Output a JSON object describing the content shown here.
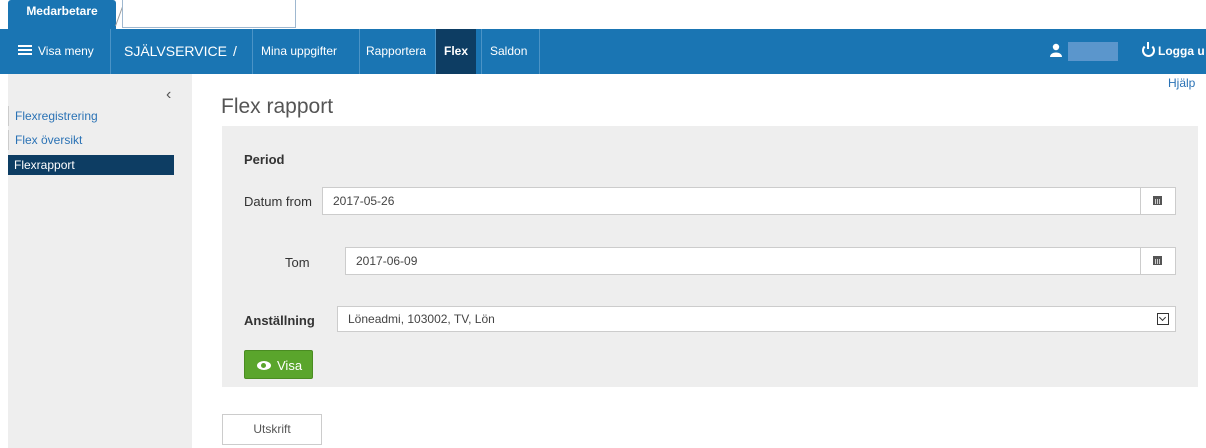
{
  "tabs": {
    "active_label": "Medarbetare"
  },
  "navbar": {
    "menu_label": "Visa meny",
    "section": "SJÄLVSERVICE",
    "separator": "/",
    "items": [
      "Mina uppgifter",
      "Rapportera",
      "Flex",
      "Saldon"
    ],
    "active_item": "Flex",
    "logout_label": "Logga u"
  },
  "sidebar": {
    "collapse_glyph": "‹",
    "items": [
      "Flexregistrering",
      "Flex översikt",
      "Flexrapport"
    ],
    "active_item": "Flexrapport"
  },
  "help_label": "Hjälp",
  "page": {
    "title": "Flex rapport",
    "period_label": "Period",
    "from_label": "Datum from",
    "from_value": "2017-05-26",
    "to_label": "Tom",
    "to_value": "2017-06-09",
    "employment_label": "Anställning",
    "employment_value": "Löneadmi, 103002, TV, Lön",
    "show_button": "Visa",
    "print_button": "Utskrift"
  },
  "colors": {
    "brand": "#1a75b3",
    "active": "#0d3d63",
    "success": "#5aa52c"
  },
  "icons": [
    "menu-icon",
    "user-icon",
    "power-icon",
    "chevron-left-icon",
    "calendar-icon",
    "select-arrow-icon",
    "eye-icon"
  ]
}
